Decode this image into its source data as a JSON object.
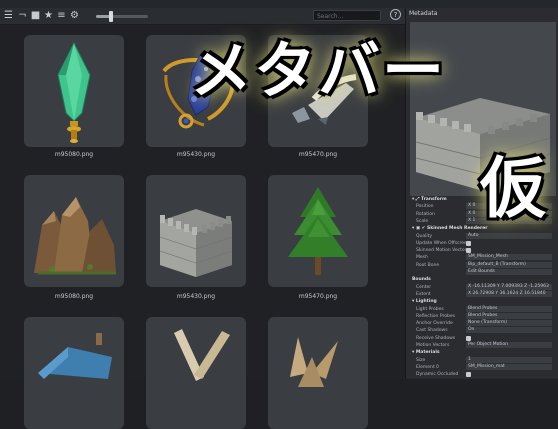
{
  "toolbar": {
    "icons": [
      "list-icon",
      "return-icon",
      "folder-icon",
      "star-icon",
      "filter-list-icon",
      "gear-icon"
    ],
    "size_slider_level": 0.3,
    "search_placeholder": "Search...",
    "help_label": "?"
  },
  "assets": [
    {
      "name": "m95080.png",
      "kind": "crystal"
    },
    {
      "name": "m95430.png",
      "kind": "ornament"
    },
    {
      "name": "m95470.png",
      "kind": "ship"
    },
    {
      "name": "m95080.png",
      "kind": "rocks"
    },
    {
      "name": "m95430.png",
      "kind": "castle"
    },
    {
      "name": "m95470.png",
      "kind": "tree"
    }
  ],
  "metadata": {
    "title": "Metadata",
    "sections": [
      {
        "type": "head",
        "label": "▾ ⤢  Transform"
      },
      {
        "type": "field",
        "label": "Position",
        "value": "X 0"
      },
      {
        "type": "field",
        "label": "Rotation",
        "value": "X 0"
      },
      {
        "type": "field",
        "label": "Scale",
        "value": "X 1"
      },
      {
        "type": "head",
        "label": "▾ ▣ ✔ Skinned Mesh Renderer"
      },
      {
        "type": "field",
        "label": "Quality",
        "value": "Auto"
      },
      {
        "type": "check",
        "label": "Update When Offscreen"
      },
      {
        "type": "check",
        "label": "Skinned Motion Vectors"
      },
      {
        "type": "field",
        "label": "Mesh",
        "value": "SM_Mission_Mesh"
      },
      {
        "type": "field",
        "label": "Root Bone",
        "value": "Bip_default_B (Transform)"
      },
      {
        "type": "field",
        "label": "",
        "value": "Edit Bounds"
      },
      {
        "type": "head",
        "label": "Bounds"
      },
      {
        "type": "field",
        "label": "Center",
        "value": "X -16.11309  Y 7.009393  Z -1.25963"
      },
      {
        "type": "field",
        "label": "Extent",
        "value": "X 26.72908  Y 36.1624  Z 16.51840"
      },
      {
        "type": "head",
        "label": "▾ Lighting"
      },
      {
        "type": "field",
        "label": "Light Probes",
        "value": "Blend Probes"
      },
      {
        "type": "field",
        "label": "Reflection Probes",
        "value": "Blend Probes"
      },
      {
        "type": "field",
        "label": "Anchor Override",
        "value": "None (Transform)"
      },
      {
        "type": "field",
        "label": "Cast Shadows",
        "value": "On"
      },
      {
        "type": "check",
        "label": "Receive Shadows"
      },
      {
        "type": "field",
        "label": "Motion Vectors",
        "value": "Per Object Motion"
      },
      {
        "type": "head",
        "label": "▾ Materials"
      },
      {
        "type": "field",
        "label": "Size",
        "value": "1"
      },
      {
        "type": "field",
        "label": "Element 0",
        "value": "SM_Mission_mat"
      },
      {
        "type": "check",
        "label": "Dynamic Occluded"
      }
    ]
  },
  "overlay": {
    "line1": "メタバー",
    "line2": "仮"
  },
  "colors": {
    "panel_bg": "#2a2c30",
    "tile_bg": "#3a3d42",
    "grid_bg": "#1f2125",
    "overlay_glow": "#f0e98a"
  }
}
